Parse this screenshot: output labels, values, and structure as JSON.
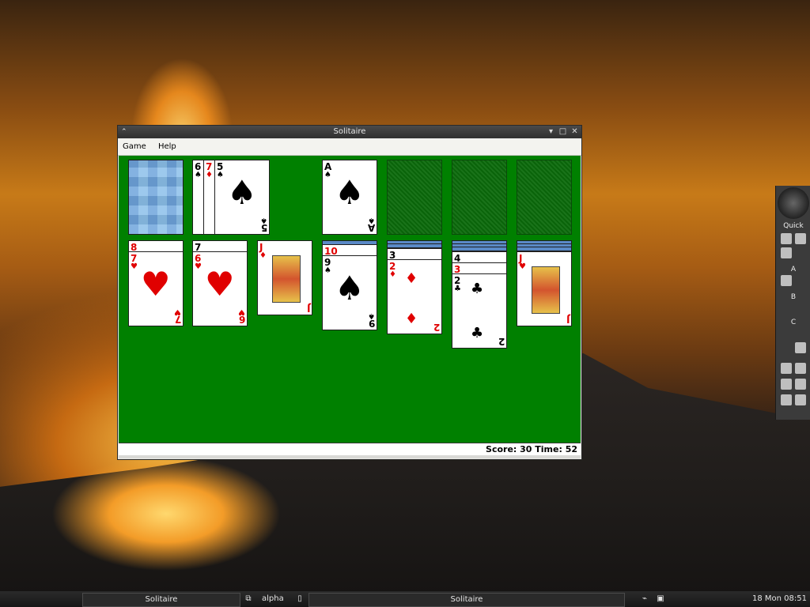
{
  "window": {
    "title": "Solitaire",
    "menu": [
      "Game",
      "Help"
    ],
    "status": "Score: 30 Time: 52"
  },
  "dock": {
    "labels": [
      "Quick",
      "A",
      "B",
      "C"
    ]
  },
  "taskbar": {
    "left_window": "Solitaire",
    "workspace": "alpha",
    "center_window": "Solitaire",
    "clock": "18 Mon 08:51"
  },
  "cards": {
    "waste": [
      {
        "rank": "6",
        "suit": "♠",
        "color": "black"
      },
      {
        "rank": "7",
        "suit": "♦",
        "color": "red"
      },
      {
        "rank": "5",
        "suit": "♠",
        "color": "black"
      }
    ],
    "foundation": {
      "rank": "A",
      "suit": "♠",
      "color": "black"
    },
    "tableau": [
      [
        {
          "rank": "8",
          "suit": "♥",
          "color": "red"
        },
        {
          "rank": "7",
          "suit": "♥",
          "color": "red"
        }
      ],
      [
        {
          "rank": "7",
          "suit": "♠",
          "color": "black"
        },
        {
          "rank": "6",
          "suit": "♥",
          "color": "red"
        }
      ],
      [
        {
          "rank": "J",
          "suit": "♦",
          "color": "red"
        }
      ],
      [
        {
          "rank": "10",
          "suit": "♥",
          "color": "red"
        },
        {
          "rank": "9",
          "suit": "♠",
          "color": "black"
        }
      ],
      [
        {
          "rank": "3",
          "suit": "♠",
          "color": "black"
        },
        {
          "rank": "2",
          "suit": "♦",
          "color": "red"
        }
      ],
      [
        {
          "rank": "4",
          "suit": "♠",
          "color": "black"
        },
        {
          "rank": "3",
          "suit": "♥",
          "color": "red"
        },
        {
          "rank": "2",
          "suit": "♣",
          "color": "black"
        }
      ],
      [
        {
          "rank": "J",
          "suit": "♥",
          "color": "red"
        }
      ]
    ]
  }
}
